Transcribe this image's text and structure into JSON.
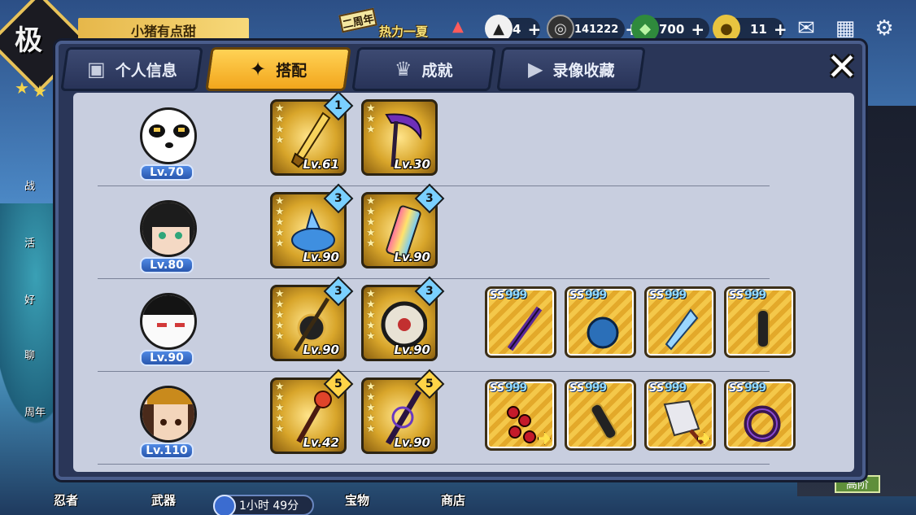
{
  "hud": {
    "rank_glyph": "极",
    "player_name": "小猪有点甜",
    "event_sign": "二周年",
    "event_title": "热力一夏",
    "currencies": [
      {
        "icon": "onigiri-icon",
        "value": "4"
      },
      {
        "icon": "coin-icon",
        "value": "141222"
      },
      {
        "icon": "green-gem-icon",
        "value": "700"
      },
      {
        "icon": "ticket-icon",
        "value": "11"
      }
    ],
    "plus": "+",
    "side_items": [
      "战",
      "活",
      "好",
      "聊",
      "周年"
    ],
    "bottom_items": [
      "忍者",
      "武器",
      "宝物",
      "商店"
    ],
    "timer": "1小时 49分",
    "high_badge": "高阶"
  },
  "dialog": {
    "tabs": [
      {
        "label": "个人信息",
        "icon": "profile-icon",
        "active": false
      },
      {
        "label": "搭配",
        "icon": "shuriken-icon",
        "active": true
      },
      {
        "label": "成就",
        "icon": "trophy-icon",
        "active": false
      },
      {
        "label": "录像收藏",
        "icon": "play-icon",
        "active": false
      }
    ],
    "close": "✕"
  },
  "lineup": [
    {
      "ninja_level": "Lv.70",
      "avatar": "panda-ninja",
      "weapons": [
        {
          "level": "Lv.61",
          "badge": "1",
          "badge_color": "blue",
          "stars": 4,
          "art": "golden-sword"
        },
        {
          "level": "Lv.30",
          "badge": "",
          "badge_color": "",
          "stars": 3,
          "art": "purple-scythe"
        }
      ],
      "scrolls": []
    },
    {
      "ninja_level": "Lv.80",
      "avatar": "leaf-girl-ninja",
      "weapons": [
        {
          "level": "Lv.90",
          "badge": "3",
          "badge_color": "blue",
          "stars": 5,
          "art": "shark-blade"
        },
        {
          "level": "Lv.90",
          "badge": "3",
          "badge_color": "blue",
          "stars": 5,
          "art": "rainbow-phone"
        }
      ],
      "scrolls": []
    },
    {
      "ninja_level": "Lv.90",
      "avatar": "fox-mask-ninja",
      "weapons": [
        {
          "level": "Lv.90",
          "badge": "3",
          "badge_color": "blue",
          "stars": 5,
          "art": "tomoe-staff"
        },
        {
          "level": "Lv.90",
          "badge": "3",
          "badge_color": "blue",
          "stars": 5,
          "art": "tomoe-shield"
        }
      ],
      "scrolls": [
        {
          "grade": "SS",
          "mark": "999",
          "art": "purple-dagger",
          "arrow": false
        },
        {
          "grade": "SS",
          "mark": "999",
          "art": "blue-orb",
          "arrow": false
        },
        {
          "grade": "SS",
          "mark": "999",
          "art": "ice-drill",
          "arrow": false
        },
        {
          "grade": "SS",
          "mark": "999",
          "art": "black-scroll",
          "arrow": false
        }
      ]
    },
    {
      "ninja_level": "Lv.110",
      "avatar": "crown-girl-ninja",
      "weapons": [
        {
          "level": "Lv.42",
          "badge": "5",
          "badge_color": "gold",
          "stars": 5,
          "art": "flame-staff"
        },
        {
          "level": "Lv.90",
          "badge": "5",
          "badge_color": "gold",
          "stars": 5,
          "art": "dark-blade"
        }
      ],
      "scrolls": [
        {
          "grade": "SS",
          "mark": "999",
          "art": "red-bead-chain",
          "arrow": true
        },
        {
          "grade": "SS",
          "mark": "999",
          "art": "black-scroll",
          "arrow": false
        },
        {
          "grade": "SS",
          "mark": "999",
          "art": "cleaver",
          "arrow": true
        },
        {
          "grade": "SS",
          "mark": "999",
          "art": "dark-ring",
          "arrow": false
        }
      ]
    }
  ]
}
